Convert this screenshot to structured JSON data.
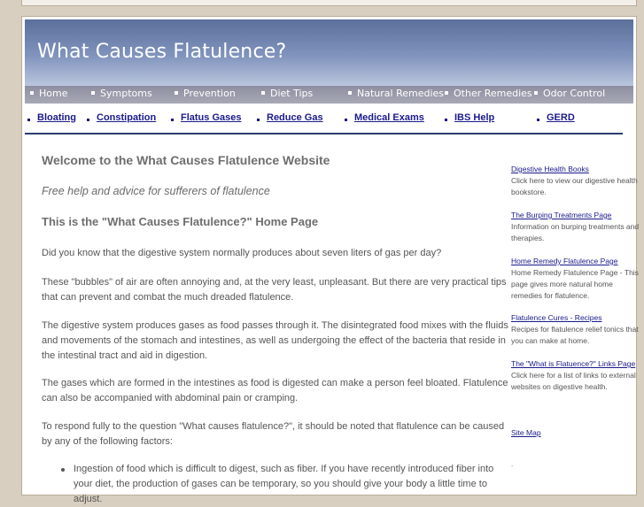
{
  "banner": {
    "title": "What Causes Flatulence?"
  },
  "nav_primary": [
    "Home",
    "Symptoms",
    "Prevention",
    "Diet Tips",
    "Natural Remedies",
    "Other Remedies",
    "Odor Control"
  ],
  "nav_secondary": [
    "Bloating",
    "Constipation",
    "Flatus Gases",
    "Reduce Gas",
    "Medical Exams",
    "IBS Help",
    "GERD"
  ],
  "main": {
    "heading": "Welcome to the What Causes Flatulence Website",
    "subheading": "Free help and advice for sufferers of flatulence",
    "section_title": "This is the \"What Causes Flatulence?\" Home Page",
    "paragraphs": [
      "Did you know that the digestive system normally produces about seven liters of gas per day?",
      "These \"bubbles\" of air are often annoying and, at the very least, unpleasant. But there are very practical tips that can prevent and combat the much dreaded flatulence.",
      "The digestive system produces gases as food passes through it. The disintegrated food mixes with the fluids and movements of the stomach and intestines, as well as undergoing the effect of the bacteria that reside in the intestinal tract and aid in digestion.",
      "The gases which are formed in the intestines as food is digested can make a person feel bloated. Flatulence can also be accompanied with abdominal pain or cramping.",
      "To respond fully to the question \"What causes flatulence?\", it should be noted that flatulence can be caused by any of the following factors:"
    ],
    "bullets": [
      "Ingestion of food which is difficult to digest, such as fiber. If you have recently introduced fiber into your diet, the production of gases can be temporary, so you should give your body a little time to adjust."
    ]
  },
  "sidebar": [
    {
      "link": "Digestive Health Books",
      "desc": "Click here to view our digestive health bookstore."
    },
    {
      "link": "The Burping Treatments Page",
      "desc": "Information on burping treatments and therapies."
    },
    {
      "link": "Home Remedy Flatulence Page",
      "desc": "Home Remedy Flatulence Page - This page gives more natural home remedies for flatulence."
    },
    {
      "link": "Flatulence Cures - Recipes",
      "desc": "Recipes for flatulence relief tonics that you can make at home."
    },
    {
      "link": "The \"What is Flatuence?\" Links Page",
      "desc": "Click here for a list of links to external websites on digestive health."
    },
    {
      "link": "Site Map",
      "desc": ""
    }
  ],
  "sidebar_trailing": "."
}
